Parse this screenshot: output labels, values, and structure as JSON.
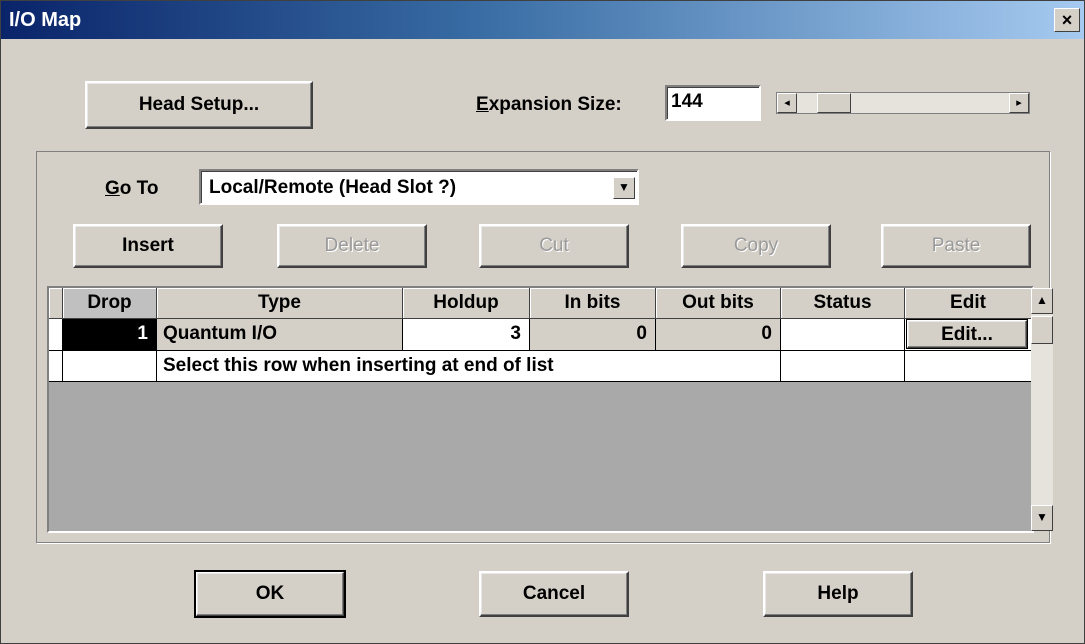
{
  "window": {
    "title": "I/O Map",
    "close_glyph": "×"
  },
  "head_setup_label": "Head Setup...",
  "expansion": {
    "label_prefix": "",
    "label_mnemonic": "E",
    "label_rest": "xpansion Size:",
    "value": "144"
  },
  "goto": {
    "label_mnemonic": "G",
    "label_rest": "o To",
    "selected": "Local/Remote (Head Slot ?)"
  },
  "toolbar": {
    "insert": "Insert",
    "delete": "Delete",
    "cut": "Cut",
    "copy": "Copy",
    "paste": "Paste"
  },
  "table": {
    "columns": [
      "Drop",
      "Type",
      "Holdup",
      "In bits",
      "Out bits",
      "Status",
      "Edit"
    ],
    "rows": [
      {
        "drop": "1",
        "type": "Quantum I/O",
        "holdup": "3",
        "in_bits": "0",
        "out_bits": "0",
        "status": "",
        "edit": "Edit..."
      }
    ],
    "insert_row_text": "Select this row when inserting at end of list"
  },
  "footer": {
    "ok": "OK",
    "cancel": "Cancel",
    "help": "Help"
  },
  "icons": {
    "dropdown": "chevron-down-icon",
    "scroll_left": "arrow-left-icon",
    "scroll_right": "arrow-right-icon",
    "scroll_up": "arrow-up-icon",
    "scroll_down": "arrow-down-icon"
  }
}
